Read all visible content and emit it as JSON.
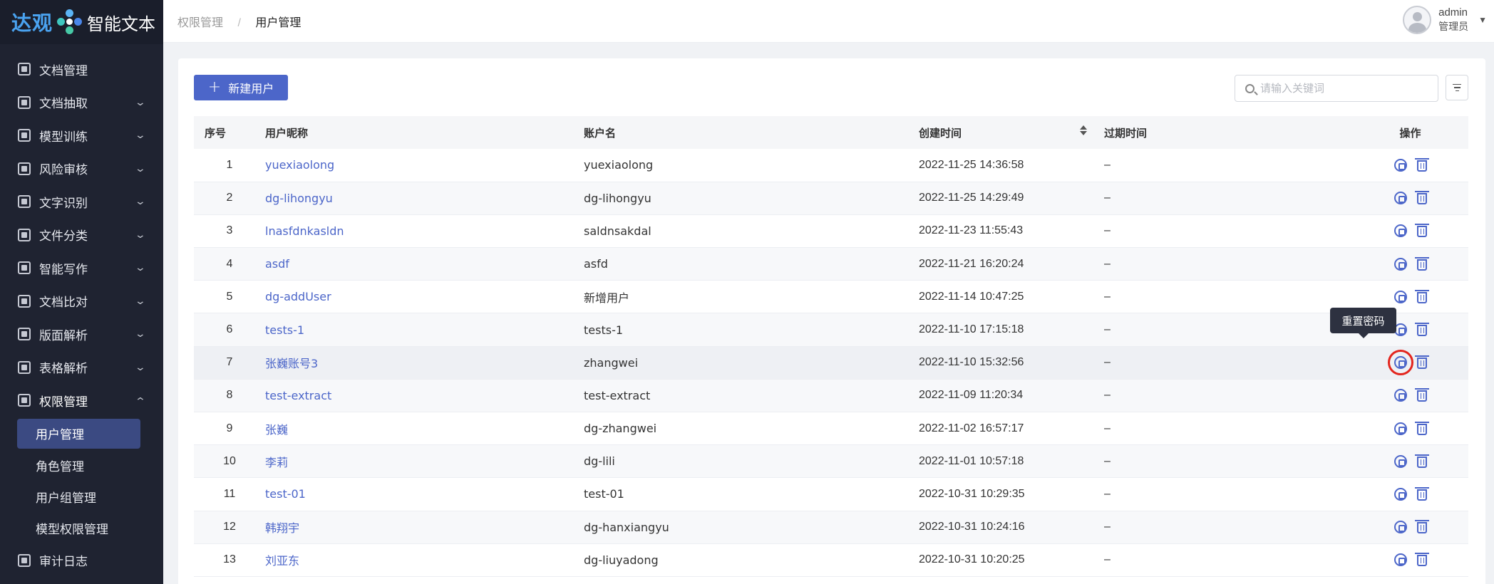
{
  "logo": {
    "brand": "达观",
    "product": "智能文本",
    "brand_color": "#4aa3f0"
  },
  "sidebar": {
    "items": [
      {
        "label": "文档管理",
        "icon": "document-icon",
        "has_children": false
      },
      {
        "label": "文档抽取",
        "icon": "extract-icon",
        "has_children": true
      },
      {
        "label": "模型训练",
        "icon": "model-icon",
        "has_children": true
      },
      {
        "label": "风险审核",
        "icon": "risk-icon",
        "has_children": true
      },
      {
        "label": "文字识别",
        "icon": "text-recognition-icon",
        "has_children": true
      },
      {
        "label": "文件分类",
        "icon": "folder-icon",
        "has_children": true
      },
      {
        "label": "智能写作",
        "icon": "writing-icon",
        "has_children": true
      },
      {
        "label": "文档比对",
        "icon": "compare-icon",
        "has_children": true
      },
      {
        "label": "版面解析",
        "icon": "layout-icon",
        "has_children": true
      },
      {
        "label": "表格解析",
        "icon": "table-icon",
        "has_children": true
      },
      {
        "label": "权限管理",
        "icon": "shield-icon",
        "has_children": true,
        "open": true
      }
    ],
    "sub_items": [
      {
        "label": "用户管理",
        "active": true
      },
      {
        "label": "角色管理"
      },
      {
        "label": "用户组管理"
      },
      {
        "label": "模型权限管理"
      }
    ],
    "bottom_item": {
      "label": "审计日志",
      "icon": "audit-log-icon"
    }
  },
  "header": {
    "breadcrumb_parent": "权限管理",
    "breadcrumb_separator": "/",
    "breadcrumb_current": "用户管理",
    "user_name": "admin",
    "user_role": "管理员"
  },
  "toolbar": {
    "new_user_label": "新建用户",
    "search_placeholder": "请输入关键词"
  },
  "table": {
    "columns": [
      "序号",
      "用户昵称",
      "账户名",
      "创建时间",
      "过期时间",
      "操作"
    ],
    "rows": [
      {
        "idx": "1",
        "nick": "yuexiaolong",
        "account": "yuexiaolong",
        "created": "2022-11-25 14:36:58",
        "expires": "–"
      },
      {
        "idx": "2",
        "nick": "dg-lihongyu",
        "account": "dg-lihongyu",
        "created": "2022-11-25 14:29:49",
        "expires": "–"
      },
      {
        "idx": "3",
        "nick": "lnasfdnkasldn",
        "account": "saldnsakdal",
        "created": "2022-11-23 11:55:43",
        "expires": "–"
      },
      {
        "idx": "4",
        "nick": "asdf",
        "account": "asfd",
        "created": "2022-11-21 16:20:24",
        "expires": "–"
      },
      {
        "idx": "5",
        "nick": "dg-addUser",
        "account": "新增用户",
        "created": "2022-11-14 10:47:25",
        "expires": "–"
      },
      {
        "idx": "6",
        "nick": "tests-1",
        "account": "tests-1",
        "created": "2022-11-10 17:15:18",
        "expires": "–"
      },
      {
        "idx": "7",
        "nick": "张巍账号3",
        "account": "zhangwei",
        "created": "2022-11-10 15:32:56",
        "expires": "–"
      },
      {
        "idx": "8",
        "nick": "test-extract",
        "account": "test-extract",
        "created": "2022-11-09 11:20:34",
        "expires": "–"
      },
      {
        "idx": "9",
        "nick": "张巍",
        "account": "dg-zhangwei",
        "created": "2022-11-02 16:57:17",
        "expires": "–"
      },
      {
        "idx": "10",
        "nick": "李莉",
        "account": "dg-lili",
        "created": "2022-11-01 10:57:18",
        "expires": "–"
      },
      {
        "idx": "11",
        "nick": "test-01",
        "account": "test-01",
        "created": "2022-10-31 10:29:35",
        "expires": "–"
      },
      {
        "idx": "12",
        "nick": "韩翔宇",
        "account": "dg-hanxiangyu",
        "created": "2022-10-31 10:24:16",
        "expires": "–"
      },
      {
        "idx": "13",
        "nick": "刘亚东",
        "account": "dg-liuyadong",
        "created": "2022-10-31 10:20:25",
        "expires": "–"
      }
    ]
  },
  "tooltip": {
    "text": "重置密码"
  },
  "colors": {
    "accent": "#4c66c9",
    "sidebar_bg": "#1f2331",
    "highlight": "#e3251d"
  }
}
